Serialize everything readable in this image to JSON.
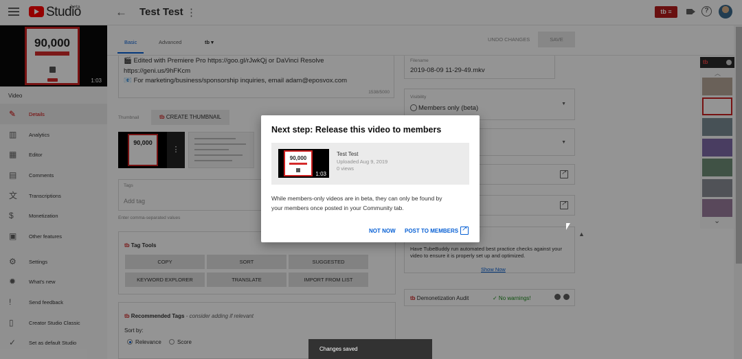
{
  "header": {
    "studio_label": "Studio",
    "beta_label": "beta",
    "video_title": "Test Test",
    "tubebuddy_badge": "tb"
  },
  "sidebar": {
    "thumb_number": "90,000",
    "duration": "1:03",
    "section_label": "Video",
    "items": [
      {
        "label": "Details",
        "icon": "pencil-icon"
      },
      {
        "label": "Analytics",
        "icon": "analytics-icon"
      },
      {
        "label": "Editor",
        "icon": "film-icon"
      },
      {
        "label": "Comments",
        "icon": "comments-icon"
      },
      {
        "label": "Transcriptions",
        "icon": "translate-icon"
      },
      {
        "label": "Monetization",
        "icon": "dollar-icon"
      },
      {
        "label": "Other features",
        "icon": "other-features-icon"
      },
      {
        "label": "Settings",
        "icon": "gear-icon"
      },
      {
        "label": "What's new",
        "icon": "whats-new-icon"
      },
      {
        "label": "Send feedback",
        "icon": "feedback-icon"
      },
      {
        "label": "Creator Studio Classic",
        "icon": "classic-icon"
      },
      {
        "label": "Set as default Studio",
        "icon": "check-circle-icon"
      }
    ]
  },
  "tabs": {
    "basic": "Basic",
    "advanced": "Advanced",
    "tb_tab": "tb",
    "undo": "UNDO CHANGES",
    "save": "SAVE"
  },
  "description": {
    "line1": "🎬 Edited with Premiere Pro https://goo.gl/rJwkQj or DaVinci Resolve",
    "line2": "https://geni.us/9hFKcm",
    "line3": "📧 For marketing/business/sponsorship inquiries, email adam@eposvox.com",
    "count": "1538/5000"
  },
  "thumbnail": {
    "label": "Thumbnail",
    "create_button": "CREATE THUMBNAIL",
    "create_prefix": "tb",
    "thumb_number": "90,000"
  },
  "tags": {
    "label": "Tags",
    "placeholder": "Add tag",
    "hint": "Enter comma-separated values"
  },
  "tag_tools": {
    "title": "Tag Tools",
    "prefix": "tb",
    "buttons": [
      "COPY",
      "SORT",
      "SUGGESTED",
      "KEYWORD EXPLORER",
      "TRANSLATE",
      "IMPORT FROM LIST"
    ]
  },
  "recommended_tags": {
    "title": "Recommended Tags",
    "subtitle": "- consider adding if relevant",
    "sort_label": "Sort by:",
    "option_relevance": "Relevance",
    "option_score": "Score",
    "selected": "Relevance"
  },
  "right": {
    "filename_label": "Filename",
    "filename_value": "2019-08-09 11-29-49.mkv",
    "visibility_label": "Visibility",
    "visibility_value": "Members only (beta)",
    "tubebuddy_hint_line1": "Have TubeBuddy run automated best practice checks against your",
    "tubebuddy_hint_line2": "video to ensure it is properly set up and optimized.",
    "show_now": "Show Now",
    "audit_prefix": "tb",
    "audit_label": "Demonetization Audit",
    "audit_status": "✓ No warnings!"
  },
  "modal": {
    "title": "Next step: Release this video to members",
    "video_title": "Test Test",
    "uploaded": "Uploaded Aug 9, 2019",
    "views": "0 views",
    "thumb_number": "90,000",
    "duration": "1:03",
    "body_line1": "While members-only videos are in beta, they can only be found by",
    "body_line2": "your members once posted in your Community tab.",
    "not_now": "NOT NOW",
    "post": "POST TO MEMBERS"
  },
  "snackbar": {
    "text": "Changes saved"
  },
  "colors": {
    "accent": "#065fd4",
    "brand_red": "#ff0000",
    "tubebuddy_red": "#b61d1d"
  }
}
